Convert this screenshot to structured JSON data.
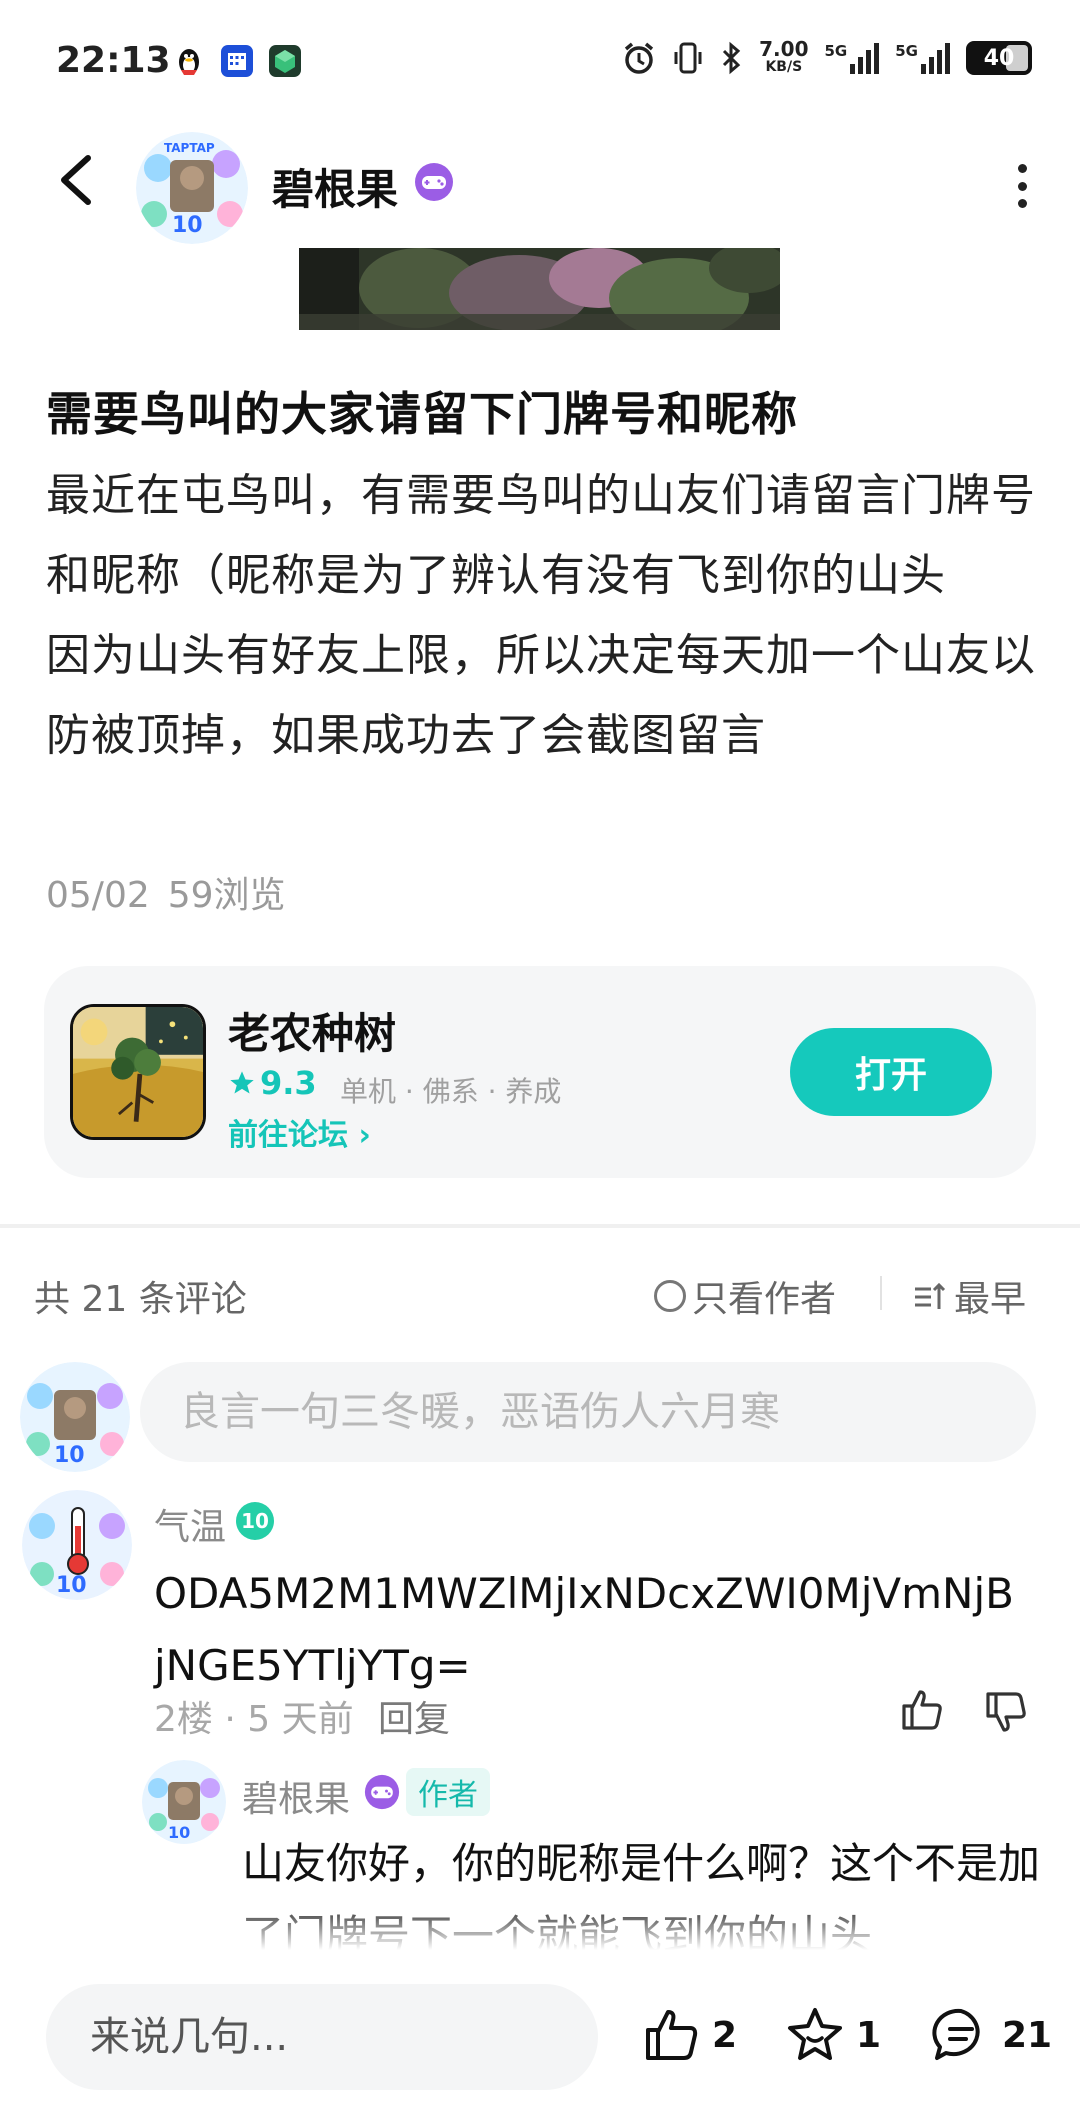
{
  "status_bar": {
    "time": "22:13",
    "net_speed": "7.00",
    "net_unit": "KB/S",
    "signal_1": "5G",
    "signal_2": "5G",
    "battery": "40"
  },
  "header": {
    "author_name": "碧根果"
  },
  "post": {
    "title": "需要鸟叫的大家请留下门牌号和昵称",
    "body_lines": [
      "最近在屯鸟叫，有需要鸟叫的山友们请留言门牌号和昵称（昵称是为了辨认有没有飞到你的山头",
      "因为山头有好友上限，所以决定每天加一个山友以防被顶掉，如果成功去了会截图留言"
    ],
    "date": "05/02",
    "views": "59浏览"
  },
  "game_card": {
    "name": "老农种树",
    "rating": "9.3",
    "tags": "单机 · 佛系 · 养成",
    "forum_link": "前往论坛 ›",
    "open_label": "打开"
  },
  "comments_header": {
    "count_label": "共 21 条评论",
    "author_only_label": "只看作者",
    "sort_label": "最早"
  },
  "composer": {
    "placeholder": "良言一句三冬暖，恶语伤人六月寒"
  },
  "comments": [
    {
      "user": "气温",
      "level": "10",
      "text": "ODA5M2M1MWZlMjIxNDcxZWI0MjVmNjBjNGE5YTljYTg=",
      "floor_time": "2楼 · 5 天前",
      "reply_label": "回复"
    }
  ],
  "reply": {
    "user": "碧根果",
    "author_tag": "作者",
    "text": "山友你好，你的昵称是什么啊？这个不是加了门牌号下一个就能飞到你的山头"
  },
  "bottom_bar": {
    "input_placeholder": "来说几句...",
    "like_count": "2",
    "favorite_count": "1",
    "comment_count": "21"
  },
  "colors": {
    "accent": "#15c9bc",
    "badge_purple": "#9b5de5",
    "level_green": "#25cfa7"
  }
}
